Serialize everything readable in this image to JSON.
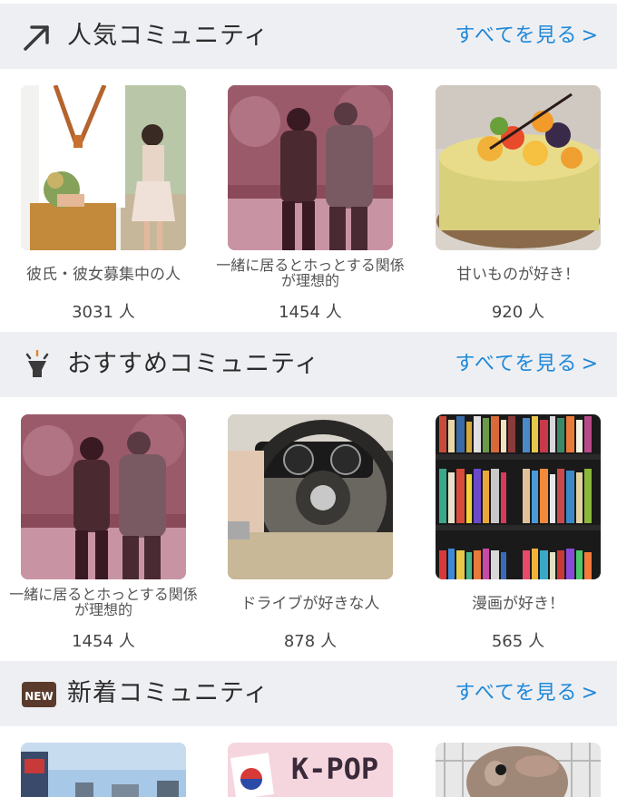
{
  "sections": [
    {
      "title": "人気コミュニティ",
      "icon": "trending-arrow-icon",
      "see_all": "すべてを見る",
      "cards": [
        {
          "title": "彼氏・彼女募集中の人",
          "count": "3031",
          "unit": "人"
        },
        {
          "title": "一緒に居るとホっとする関係が理想的",
          "count": "1454",
          "unit": "人"
        },
        {
          "title": "甘いものが好き！",
          "count": "920",
          "unit": "人"
        }
      ]
    },
    {
      "title": "おすすめコミュニティ",
      "icon": "lightbulb-icon",
      "see_all": "すべてを見る",
      "cards": [
        {
          "title": "一緒に居るとホっとする関係が理想的",
          "count": "1454",
          "unit": "人"
        },
        {
          "title": "ドライブが好きな人",
          "count": "878",
          "unit": "人"
        },
        {
          "title": "漫画が好き！",
          "count": "565",
          "unit": "人"
        }
      ]
    },
    {
      "title": "新着コミュニティ",
      "icon": "new-badge-icon",
      "badge": "NEW",
      "see_all": "すべてを見る",
      "cards": [
        {
          "thumb_text": "K-POP"
        }
      ]
    }
  ],
  "chevron": ">",
  "colors": {
    "header_bg": "#eeeff3",
    "link": "#1e88d9",
    "badge_bg": "#5a3b2b"
  }
}
